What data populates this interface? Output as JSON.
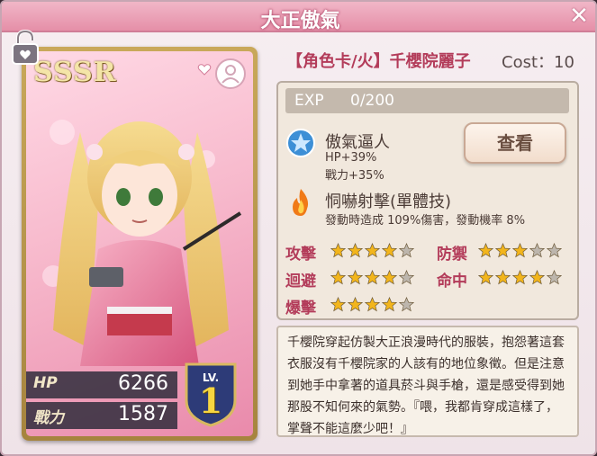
{
  "window": {
    "title": "大正傲氣"
  },
  "card": {
    "rarity": "SSSR",
    "hp_label": "HP",
    "hp_value": "6266",
    "power_label": "戰力",
    "power_value": "1587",
    "level_label": "LV.",
    "level_value": "1"
  },
  "info": {
    "name": "【角色卡/火】千櫻院麗子",
    "cost": "Cost：10",
    "exp_label": "EXP",
    "exp_value": "0/200",
    "skill1": {
      "name": "傲氣逼人",
      "line1": "HP+39%",
      "line2": "戰力+35%"
    },
    "view_button": "查看",
    "skill2": {
      "name": "恫嚇射擊(單體技)",
      "desc": "發動時造成 109%傷害，發動機率 8%"
    },
    "attributes": [
      {
        "label": "攻擊",
        "stars": 4,
        "max": 5
      },
      {
        "label": "防禦",
        "stars": 3,
        "max": 5
      },
      {
        "label": "迴避",
        "stars": 4,
        "max": 5
      },
      {
        "label": "命中",
        "stars": 4,
        "max": 5
      },
      {
        "label": "爆擊",
        "stars": 4,
        "max": 5
      }
    ]
  },
  "description": "千櫻院穿起仿製大正浪漫時代的服裝，抱怨著這套衣服沒有千櫻院家的人該有的地位象徵。但是注意到她手中拿著的道具菸斗與手槍，還是感受得到她那股不知何來的氣勢。『喂，我都肯穿成這樣了，掌聲不能這麼少吧！』",
  "colors": {
    "accent": "#b33c5a",
    "star_on": "#f2b51c",
    "star_off": "#bdb6ad"
  }
}
